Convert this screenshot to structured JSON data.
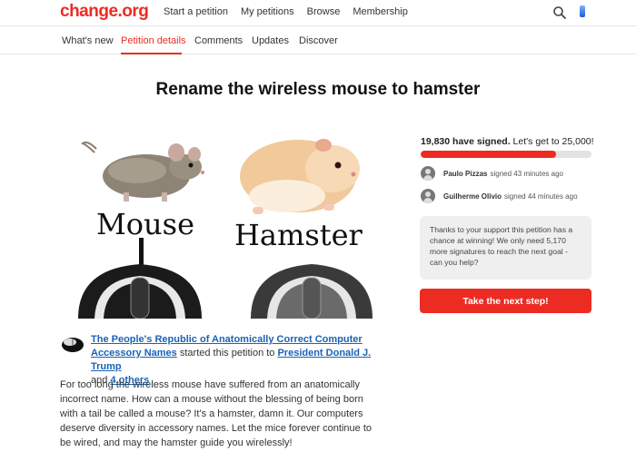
{
  "topnav": {
    "logo": "change.org",
    "links": [
      "Start a petition",
      "My petitions",
      "Browse",
      "Membership"
    ]
  },
  "subnav": {
    "tabs": [
      "What's new",
      "Petition details",
      "Comments",
      "Updates",
      "Discover"
    ],
    "active": "Petition details"
  },
  "petition": {
    "title": "Rename the wireless mouse to hamster",
    "image": {
      "left_caption": "Mouse",
      "right_caption": "Hamster"
    },
    "starter": {
      "org": "The People's Republic of Anatomically Correct Computer Accessory Names",
      "text_started": " started this petition to ",
      "target": "President Donald J. Trump",
      "text_and": " and ",
      "others": "4 others"
    },
    "description": "For too long the wireless mouse have suffered from an anatomically incorrect name. How can a mouse without the blessing of being born with a tail be called a mouse? It's a hamster, damn it. Our computers deserve diversity in accessory names. Let the mice forever continue to be wired, and may the hamster guide you wirelessly!"
  },
  "signatures": {
    "count_text": "19,830 have signed.",
    "goal_text": " Let's get to 25,000!",
    "progress": 0.7932,
    "recent": [
      {
        "name": "Paulo Pizzas",
        "time": "signed 43 minutes ago"
      },
      {
        "name": "Guilherme Olivio",
        "time": "signed 44 minutes ago"
      }
    ]
  },
  "promo": {
    "text": "Thanks to your support this petition has a chance at winning! We only need 5,170 more signatures to reach the next goal - can you help?"
  },
  "cta": {
    "label": "Take the next step!"
  },
  "colors": {
    "brand": "#ec2c22",
    "link": "#1a63b5"
  },
  "icons": [
    "search-icon",
    "user-avatar-icon",
    "mouse-icon"
  ]
}
